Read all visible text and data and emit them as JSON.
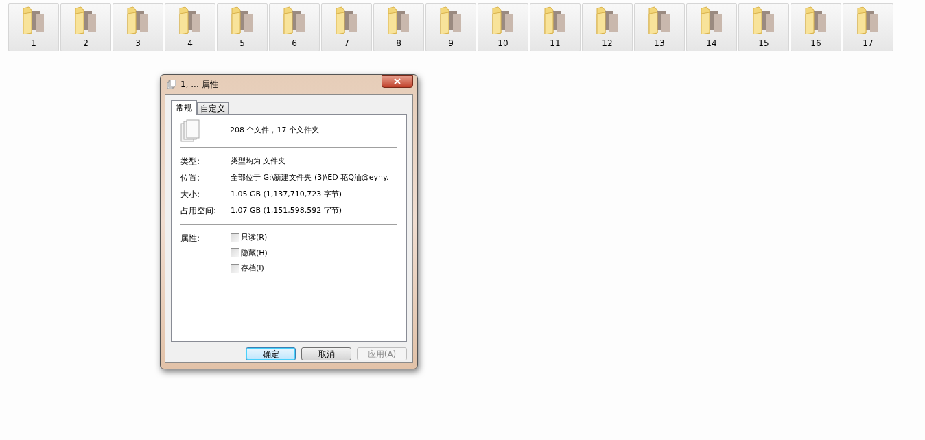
{
  "folders": [
    {
      "label": "1"
    },
    {
      "label": "2"
    },
    {
      "label": "3"
    },
    {
      "label": "4"
    },
    {
      "label": "5"
    },
    {
      "label": "6"
    },
    {
      "label": "7"
    },
    {
      "label": "8"
    },
    {
      "label": "9"
    },
    {
      "label": "10"
    },
    {
      "label": "11"
    },
    {
      "label": "12"
    },
    {
      "label": "13"
    },
    {
      "label": "14"
    },
    {
      "label": "15"
    },
    {
      "label": "16"
    },
    {
      "label": "17"
    }
  ],
  "dialog": {
    "title": "1, ... 属性",
    "tabs": [
      {
        "label": "常规",
        "selected": true
      },
      {
        "label": "自定义",
        "selected": false
      }
    ],
    "summary": "208 个文件，17 个文件夹",
    "properties": [
      {
        "label": "类型:",
        "value": "类型均为 文件夹"
      },
      {
        "label": "位置:",
        "value": "全部位于 G:\\新建文件夹 (3)\\ED 花Q油@eyny."
      },
      {
        "label": "大小:",
        "value": "1.05 GB (1,137,710,723 字节)"
      },
      {
        "label": "占用空间:",
        "value": "1.07 GB (1,151,598,592 字节)"
      }
    ],
    "attributes_label": "属性:",
    "attributes": [
      {
        "label": "只读(R)",
        "checked": false
      },
      {
        "label": "隐藏(H)",
        "checked": false
      },
      {
        "label": "存档(I)",
        "checked": false
      }
    ],
    "buttons": [
      {
        "label": "确定",
        "default": true,
        "disabled": false
      },
      {
        "label": "取消",
        "default": false,
        "disabled": false
      },
      {
        "label": "应用(A)",
        "default": false,
        "disabled": true
      }
    ]
  }
}
